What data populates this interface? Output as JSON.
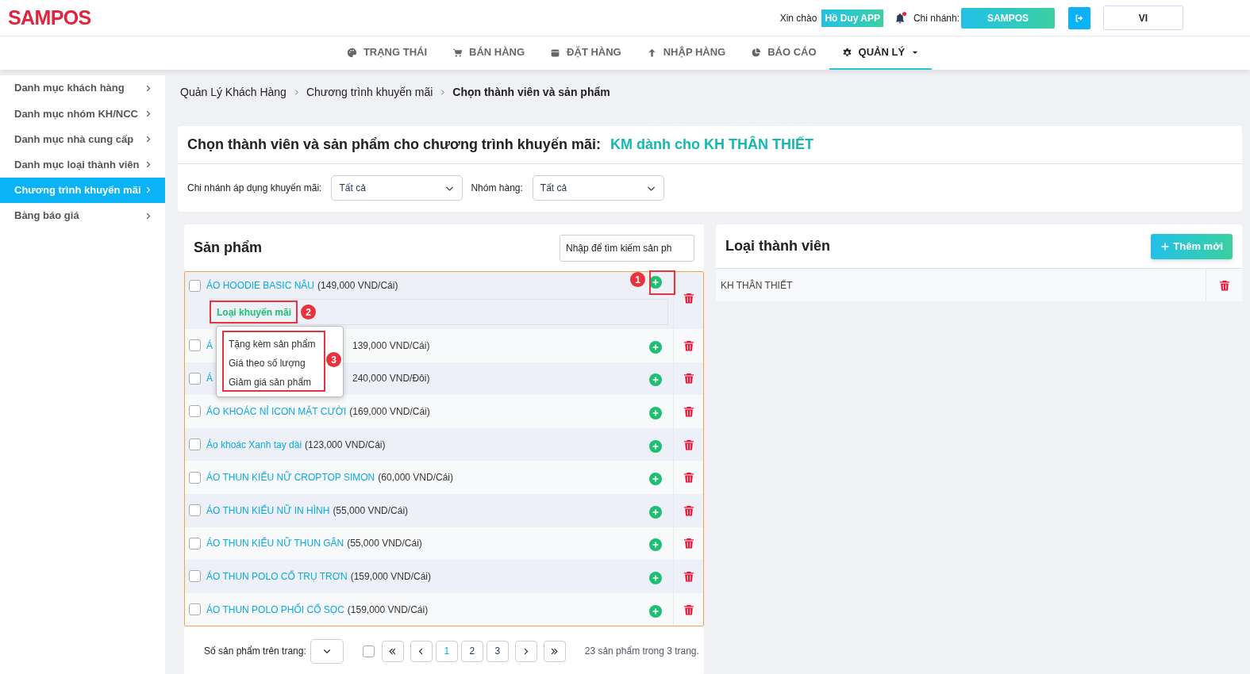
{
  "header": {
    "logo": "SAMPOS",
    "greeting": "Xin chào",
    "user": "Hồ Duy APP",
    "branch_label": "Chi nhánh:",
    "branch": "SAMPOS",
    "language": "VI",
    "notification_dot": true
  },
  "nav": [
    {
      "label": "TRẠNG THÁI",
      "selected": false
    },
    {
      "label": "BÁN HÀNG",
      "selected": false
    },
    {
      "label": "ĐẶT HÀNG",
      "selected": false
    },
    {
      "label": "NHẬP HÀNG",
      "selected": false
    },
    {
      "label": "BÁO CÁO",
      "selected": false
    },
    {
      "label": "QUẢN LÝ",
      "selected": true
    }
  ],
  "sidebar": {
    "items": [
      {
        "label": "Danh mục khách hàng",
        "selected": false
      },
      {
        "label": "Danh mục nhóm KH/NCC",
        "selected": false
      },
      {
        "label": "Danh mục nhà cung cấp",
        "selected": false
      },
      {
        "label": "Danh mục loại thành viên",
        "selected": false
      },
      {
        "label": "Chương trình khuyến mãi",
        "selected": true
      },
      {
        "label": "Bảng báo giá",
        "selected": false
      }
    ]
  },
  "breadcrumb": [
    "Quản Lý Khách Hàng",
    "Chương trình khuyến mãi",
    "Chọn thành viên và sản phẩm"
  ],
  "title": {
    "text": "Chọn thành viên và sản phẩm cho chương trình khuyến mãi:",
    "program": "KM dành cho KH THÂN THIẾT"
  },
  "filters": [
    {
      "label": "Chi nhánh áp dụng khuyến mãi:",
      "value": "Tất cả"
    },
    {
      "label": "Nhóm hàng:",
      "value": "Tất cả"
    }
  ],
  "products": {
    "title": "Sản phẩm",
    "search_placeholder": "Nhập để tìm kiếm sản ph",
    "rows": [
      {
        "kind": "expanded",
        "name": "ÁO HOODIE BASIC NÂU",
        "price": "(149,000 VND/Cái)",
        "checked": false,
        "promo_label": "Loại khuyến mãi"
      },
      {
        "kind": "covered",
        "name": "Á",
        "price": "139,000 VND/Cái)",
        "checked": false
      },
      {
        "kind": "covered",
        "name": "Á",
        "price": "240,000 VND/Đôi)",
        "checked": false
      },
      {
        "kind": "plain",
        "name": "ÁO KHOÁC NỈ ICON MẶT CƯỜI",
        "price": "(169,000 VND/Cái)",
        "checked": false
      },
      {
        "kind": "plain",
        "name": "Áo khoác Xanh tay dài",
        "price": "(123,000 VND/Cái)",
        "checked": false
      },
      {
        "kind": "plain",
        "name": "ÁO THUN KIỂU NỮ CROPTOP SIMON",
        "price": "(60,000 VND/Cái)",
        "checked": false
      },
      {
        "kind": "plain",
        "name": "ÁO THUN KIỂU NỮ IN HÌNH",
        "price": "(55,000 VND/Cái)",
        "checked": false
      },
      {
        "kind": "plain",
        "name": "ÁO THUN KIỂU NỮ THUN GÂN",
        "price": "(55,000 VND/Cái)",
        "checked": false
      },
      {
        "kind": "plain",
        "name": "ÁO THUN POLO CỔ TRỤ TRƠN",
        "price": "(159,000 VND/Cái)",
        "checked": false
      },
      {
        "kind": "plain",
        "name": "ÁO THUN POLO PHỐI CỔ SỌC",
        "price": "(159,000 VND/Cái)",
        "checked": false
      }
    ],
    "promo_menu": [
      "Tặng kèm sản phẩm",
      "Giá theo số lượng",
      "Giảm giá sản phẩm"
    ],
    "annotations": [
      "1",
      "2",
      "3"
    ],
    "pager": {
      "label": "Số sản phẩm trên trang:",
      "all_checked": false,
      "pages": [
        {
          "label": "1",
          "selected": true
        },
        {
          "label": "2",
          "selected": false
        },
        {
          "label": "3",
          "selected": false
        }
      ],
      "summary": "23 sản phẩm trong 3 trang."
    }
  },
  "members": {
    "title": "Loại thành viên",
    "add_button": "Thêm mới",
    "rows": [
      "KH THÂN THIẾT"
    ]
  }
}
